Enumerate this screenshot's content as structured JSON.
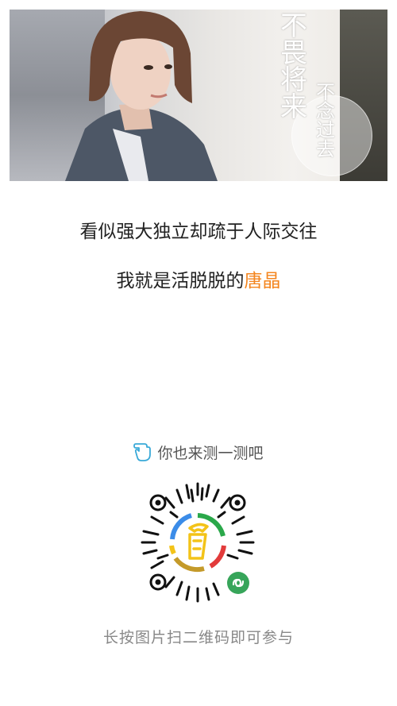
{
  "poster": {
    "title_main": "不畏将来",
    "title_sub": "不念过去"
  },
  "text": {
    "line1": "看似强大独立却疏于人际交往",
    "line2_prefix": "我就是活脱脱的",
    "line2_highlight": "唐晶"
  },
  "invite": {
    "label": "你也来测一测吧",
    "icon": "pointing-hand-icon"
  },
  "qr": {
    "icon": "mini-program-code-icon",
    "badge_icon": "mini-program-badge-icon"
  },
  "hint": {
    "label": "长按图片扫二维码即可参与"
  },
  "colors": {
    "highlight": "#f4851e",
    "text": "#222222",
    "muted": "#888888"
  }
}
